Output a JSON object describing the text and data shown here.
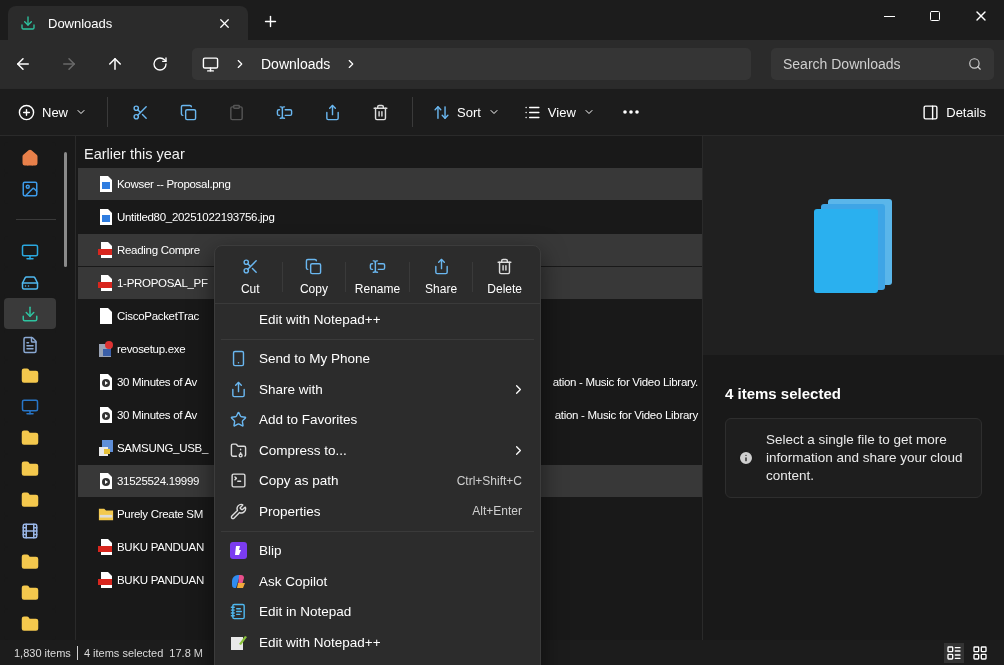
{
  "tab": {
    "title": "Downloads",
    "selected": true
  },
  "nav": [
    {
      "kind": "back",
      "disabled": false
    },
    {
      "kind": "forward",
      "disabled": true
    },
    {
      "kind": "up",
      "disabled": false
    },
    {
      "kind": "refresh",
      "disabled": false
    }
  ],
  "address": {
    "crumbs": [
      "Downloads"
    ]
  },
  "search": {
    "placeholder": "Search Downloads"
  },
  "toolbar": {
    "new": "New",
    "sort": "Sort",
    "view": "View",
    "details": "Details",
    "buttons": [
      {
        "kind": "cut",
        "disabled": false
      },
      {
        "kind": "copy",
        "disabled": false
      },
      {
        "kind": "paste",
        "disabled": true
      },
      {
        "kind": "rename",
        "disabled": false
      },
      {
        "kind": "share",
        "disabled": false
      },
      {
        "kind": "delete",
        "disabled": false
      }
    ]
  },
  "sidebar": {
    "items": [
      {
        "kind": "home",
        "selected": false
      },
      {
        "kind": "gallery",
        "selected": false
      },
      {
        "kind": "divider"
      },
      {
        "kind": "desktop",
        "selected": false
      },
      {
        "kind": "drive",
        "selected": false
      },
      {
        "kind": "downloads",
        "selected": true
      },
      {
        "kind": "document",
        "selected": false
      },
      {
        "kind": "folder",
        "selected": false
      },
      {
        "kind": "screen",
        "selected": false
      },
      {
        "kind": "folder",
        "selected": false
      },
      {
        "kind": "folder",
        "selected": false
      },
      {
        "kind": "folder",
        "selected": false
      },
      {
        "kind": "video",
        "selected": false
      },
      {
        "kind": "folder",
        "selected": false
      },
      {
        "kind": "folder",
        "selected": false
      },
      {
        "kind": "folder",
        "selected": false
      }
    ]
  },
  "files": {
    "group": "Earlier this year",
    "rows": [
      {
        "kind": "image",
        "name": "Kowser -- Proposal.png",
        "selected": true
      },
      {
        "kind": "image",
        "name": "Untitled80_20251022193756.jpg",
        "selected": false
      },
      {
        "kind": "pdf",
        "name": "Reading Compre",
        "selected": true
      },
      {
        "kind": "pdf",
        "name": "1-PROPOSAL_PF",
        "selected": true
      },
      {
        "kind": "blank",
        "name": "CiscoPacketTrac",
        "selected": false
      },
      {
        "kind": "setup",
        "name": "revosetup.exe",
        "selected": false
      },
      {
        "kind": "media",
        "name": "30 Minutes of Av",
        "tail": "ation - Music for Video Library.",
        "selected": false
      },
      {
        "kind": "media",
        "name": "30 Minutes of Av",
        "tail": "ation - Music for Video Library",
        "selected": false
      },
      {
        "kind": "installer",
        "name": "SAMSUNG_USB_",
        "selected": false
      },
      {
        "kind": "media",
        "name": "31525524.19999",
        "selected": true
      },
      {
        "kind": "zip",
        "name": "Purely Create SM",
        "selected": false
      },
      {
        "kind": "pdf",
        "name": "BUKU PANDUAN",
        "selected": false
      },
      {
        "kind": "pdf",
        "name": "BUKU PANDUAN",
        "selected": false
      }
    ]
  },
  "details": {
    "title": "4 items selected",
    "info": "Select a single file to get more information and share your cloud content."
  },
  "status": {
    "count": "1,830 items",
    "selection": "4 items selected",
    "size": "17.8 M",
    "views": [
      {
        "kind": "details",
        "selected": true
      },
      {
        "kind": "tiles",
        "selected": false
      }
    ]
  },
  "context_menu": {
    "quick": [
      {
        "kind": "cut",
        "label": "Cut"
      },
      {
        "kind": "copy",
        "label": "Copy"
      },
      {
        "kind": "rename",
        "label": "Rename"
      },
      {
        "kind": "share",
        "label": "Share"
      },
      {
        "kind": "delete",
        "label": "Delete"
      }
    ],
    "sections": [
      [
        {
          "kind": "none",
          "label": "Edit with Notepad++",
          "submenu": false
        }
      ],
      [
        {
          "kind": "phone",
          "label": "Send to My Phone",
          "submenu": false
        },
        {
          "kind": "sharewith",
          "label": "Share with",
          "submenu": true
        },
        {
          "kind": "star",
          "label": "Add to Favorites",
          "submenu": false
        },
        {
          "kind": "compress",
          "label": "Compress to...",
          "submenu": true
        },
        {
          "kind": "path",
          "label": "Copy as path",
          "shortcut": "Ctrl+Shift+C",
          "submenu": false
        },
        {
          "kind": "wrench",
          "label": "Properties",
          "shortcut": "Alt+Enter",
          "submenu": false
        }
      ],
      [
        {
          "kind": "blip",
          "label": "Blip",
          "submenu": false
        },
        {
          "kind": "copilot",
          "label": "Ask Copilot",
          "submenu": false
        },
        {
          "kind": "notepad",
          "label": "Edit in Notepad",
          "submenu": false
        },
        {
          "kind": "notepadpp",
          "label": "Edit with Notepad++",
          "submenu": false
        }
      ]
    ]
  }
}
